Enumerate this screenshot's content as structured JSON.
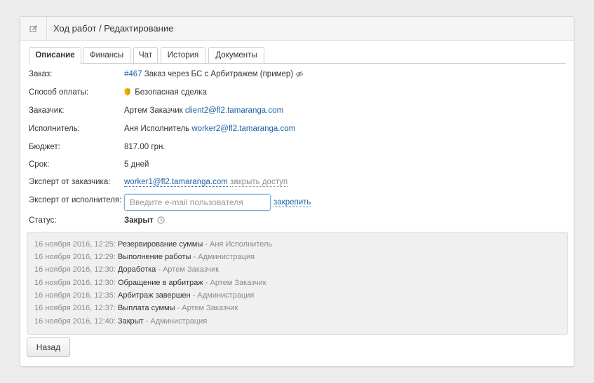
{
  "header": {
    "title": "Ход работ / Редактирование",
    "icon": "edit-icon"
  },
  "tabs": [
    {
      "label": "Описание",
      "active": true
    },
    {
      "label": "Финансы",
      "active": false
    },
    {
      "label": "Чат",
      "active": false
    },
    {
      "label": "История",
      "active": false
    },
    {
      "label": "Документы",
      "active": false
    }
  ],
  "details": {
    "order": {
      "label": "Заказ:",
      "number": "#467",
      "title": "Заказ через БС с Арбитражем (пример)"
    },
    "payment": {
      "label": "Способ оплаты:",
      "value": "Безопасная сделка",
      "icon_color": "#f2b600"
    },
    "customer": {
      "label": "Заказчик:",
      "name": "Артем Заказчик",
      "email": "client2@fl2.tamaranga.com"
    },
    "performer": {
      "label": "Исполнитель:",
      "name": "Аня Исполнитель",
      "email": "worker2@fl2.tamaranga.com"
    },
    "budget": {
      "label": "Бюджет:",
      "value": "817.00 грн."
    },
    "term": {
      "label": "Срок:",
      "value": "5 дней"
    },
    "customer_expert": {
      "label": "Эксперт от заказчика:",
      "email": "worker1@fl2.tamaranga.com",
      "action": "закрыть доступ"
    },
    "performer_expert": {
      "label": "Эксперт от исполнителя:",
      "placeholder": "Введите e-mail пользователя",
      "value": "",
      "action": "закрепить"
    },
    "status": {
      "label": "Статус:",
      "value": "Закрыт"
    }
  },
  "history": [
    {
      "date": "16 ноября 2016, 12:25:",
      "event": "Резервирование суммы",
      "who": "- Аня Исполнитель"
    },
    {
      "date": "16 ноября 2016, 12:29:",
      "event": "Выполнение работы",
      "who": "- Администрация"
    },
    {
      "date": "16 ноября 2016, 12:30:",
      "event": "Доработка",
      "who": "- Артем Заказчик"
    },
    {
      "date": "16 ноября 2016, 12:30:",
      "event": "Обращение в арбитраж",
      "who": "- Артем Заказчик"
    },
    {
      "date": "16 ноября 2016, 12:35:",
      "event": "Арбитраж завершен",
      "who": "- Администрация"
    },
    {
      "date": "16 ноября 2016, 12:37:",
      "event": "Выплата суммы",
      "who": "- Артем Заказчик"
    },
    {
      "date": "16 ноября 2016, 12:40:",
      "event": "Закрыт",
      "who": "- Администрация"
    }
  ],
  "back_label": "Назад",
  "colors": {
    "link": "#1e62a8",
    "muted": "#8a8a8a",
    "shield": "#f2b600"
  }
}
